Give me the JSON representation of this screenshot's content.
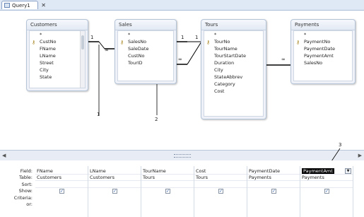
{
  "window": {
    "tab_title": "Query1",
    "close_glyph": "✕"
  },
  "tables": [
    {
      "name": "Customers",
      "fields": [
        "*",
        "CustNo",
        "FName",
        "LName",
        "Street",
        "City",
        "State"
      ],
      "key_field": "CustNo"
    },
    {
      "name": "Sales",
      "fields": [
        "*",
        "SalesNo",
        "SaleDate",
        "CustNo",
        "TourID"
      ],
      "key_field": "SalesNo"
    },
    {
      "name": "Tours",
      "fields": [
        "*",
        "TourNo",
        "TourName",
        "TourStartDate",
        "Duration",
        "City",
        "StateAbbrev",
        "Category",
        "Cost"
      ],
      "key_field": "TourNo"
    },
    {
      "name": "Payments",
      "fields": [
        "*",
        "PaymentNo",
        "PaymentDate",
        "PaymentAmt",
        "SalesNo"
      ],
      "key_field": "PaymentNo"
    }
  ],
  "relationships": {
    "one_label": "1",
    "many_label": "∞"
  },
  "callouts": [
    "1",
    "2",
    "3"
  ],
  "grid": {
    "row_labels": [
      "Field:",
      "Table:",
      "Sort:",
      "Show:",
      "Criteria:",
      "or:"
    ],
    "columns": [
      {
        "field": "FName",
        "table": "Customers",
        "show": true
      },
      {
        "field": "LName",
        "table": "Customers",
        "show": true
      },
      {
        "field": "TourName",
        "table": "Tours",
        "show": true
      },
      {
        "field": "Cost",
        "table": "Tours",
        "show": true
      },
      {
        "field": "PaymentDate",
        "table": "Payments",
        "show": true
      },
      {
        "field": "PaymentAmt",
        "table": "Payments",
        "show": true,
        "selected": true
      }
    ]
  },
  "check_glyph": "✓",
  "dropdown_glyph": "▼",
  "colors": {
    "selection": "#000000",
    "accent": "#2d5aa8"
  }
}
